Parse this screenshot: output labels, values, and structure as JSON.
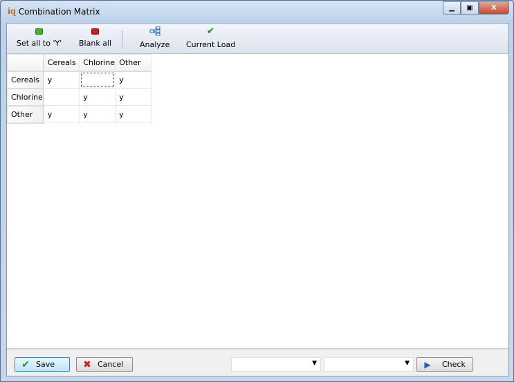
{
  "window": {
    "title": "Combination Matrix",
    "logo": "iq"
  },
  "toolbar": {
    "set_all": "Set all to 'Y'",
    "blank_all": "Blank all",
    "analyze": "Analyze",
    "current_load": "Current Load",
    "colors": {
      "set_all": "#3cb521",
      "blank_all": "#d11a1a",
      "current_load": "#1a9a1a"
    }
  },
  "matrix": {
    "columns": [
      "Cereals",
      "Chlorine",
      "Other"
    ],
    "rows": [
      {
        "label": "Cereals",
        "cells": [
          "y",
          "",
          "y"
        ]
      },
      {
        "label": "Chlorine",
        "cells": [
          "",
          "y",
          "y"
        ]
      },
      {
        "label": "Other",
        "cells": [
          "y",
          "y",
          "y"
        ]
      }
    ]
  },
  "footer": {
    "save": "Save",
    "cancel": "Cancel",
    "check": "Check",
    "dropdown1": "",
    "dropdown2": ""
  }
}
